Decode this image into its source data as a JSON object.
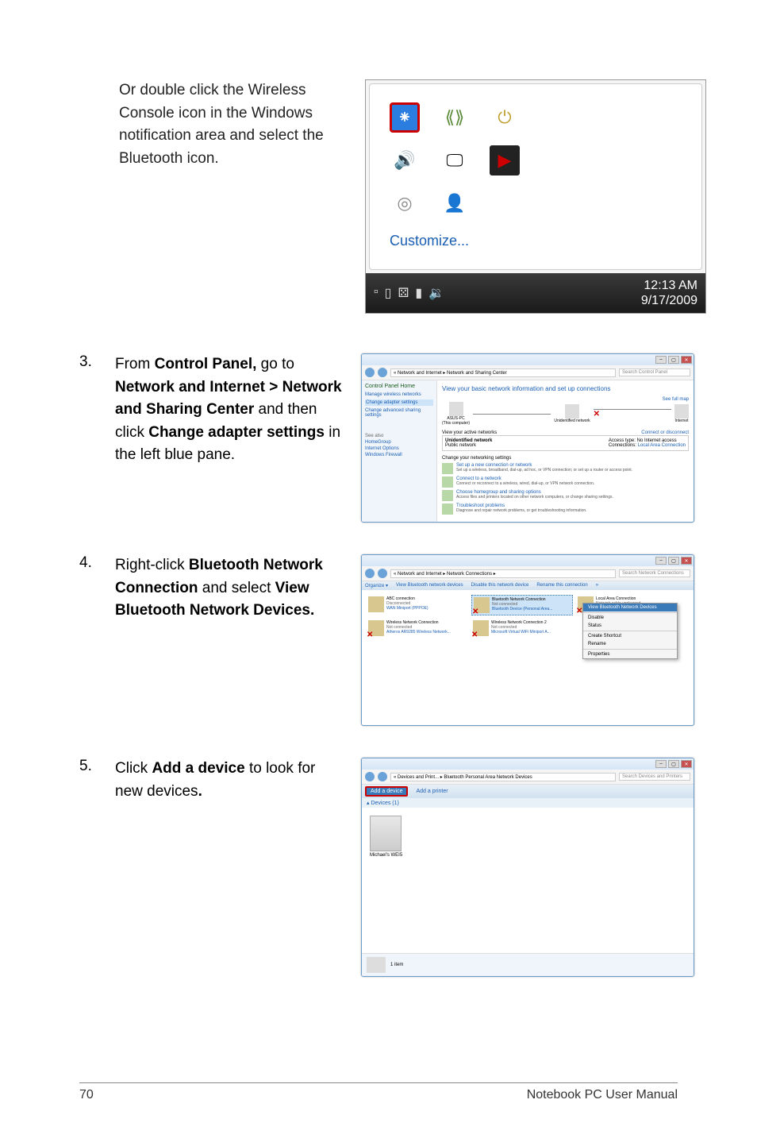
{
  "intro_text": "Or double click the Wireless Console icon in the Windows notification area and select the Bluetooth icon.",
  "steps": {
    "s3": {
      "num": "3.",
      "text_pre": "From ",
      "b1": "Control Panel,",
      "t2": " go to ",
      "b2": "Network and Internet > Network and Sharing Center",
      "t3": " and then click ",
      "b3": "Change adapter settings",
      "t4": " in the left blue pane."
    },
    "s4": {
      "num": "4.",
      "t1": "Right-click ",
      "b1": "Bluetooth Network Connection",
      "t2": " and select ",
      "b2": "View Bluetooth Network Devices."
    },
    "s5": {
      "num": "5.",
      "t1": "Click ",
      "b1": "Add a device",
      "t2": " to look for new devices",
      "b2": "."
    }
  },
  "systray": {
    "customize": "Customize...",
    "clock_time": "12:13 AM",
    "clock_date": "9/17/2009"
  },
  "ncs": {
    "path": "« Network and Internet ▸ Network and Sharing Center",
    "search_ph": "Search Control Panel",
    "sidebar_title": "Control Panel Home",
    "sb_links": [
      "Manage wireless networks",
      "Change adapter settings",
      "Change advanced sharing settings"
    ],
    "seealso_title": "See also",
    "seealso": [
      "HomeGroup",
      "Internet Options",
      "Windows Firewall"
    ],
    "heading": "View your basic network information and set up connections",
    "full_map": "See full map",
    "node1": "ASUS-PC",
    "node1b": "(This computer)",
    "node2": "Unidentified network",
    "node3": "Internet",
    "active_nets": "View your active networks",
    "conn_disc": "Connect or disconnect",
    "unid": "Unidentified network",
    "pubnet": "Public network",
    "acc_type": "Access type:",
    "acc_val": "No Internet access",
    "conns": "Connections:",
    "conns_val": "Local Area Connection",
    "change_hdr": "Change your networking settings",
    "opt1_t": "Set up a new connection or network",
    "opt1_d": "Set up a wireless, broadband, dial-up, ad hoc, or VPN connection; or set up a router or access point.",
    "opt2_t": "Connect to a network",
    "opt2_d": "Connect or reconnect to a wireless, wired, dial-up, or VPN network connection.",
    "opt3_t": "Choose homegroup and sharing options",
    "opt3_d": "Access files and printers located on other network computers, or change sharing settings.",
    "opt4_t": "Troubleshoot problems",
    "opt4_d": "Diagnose and repair network problems, or get troubleshooting information."
  },
  "netconn": {
    "path": "« Network and Internet ▸ Network Connections ▸",
    "search_ph": "Search Network Connections",
    "tb": [
      "Organize ▾",
      "View Bluetooth network devices",
      "Disable this network device",
      "Rename this connection",
      "»"
    ],
    "items": [
      {
        "n1": "ABC connection",
        "n2": "Disconnected",
        "n3": "WAN Miniport (PPPOE)"
      },
      {
        "n1": "Bluetooth Network Connection",
        "n2": "Not connected",
        "n3": "Bluetooth Device (Personal Area..."
      },
      {
        "n1": "Local Area Connection",
        "n2": "Network cable unplugged",
        "n3": ""
      },
      {
        "n1": "Wireless Network Connection",
        "n2": "Not connected",
        "n3": "Atheros AR9285 Wireless Network..."
      },
      {
        "n1": "Wireless Network Connection 2",
        "n2": "Not connected",
        "n3": "Microsoft Virtual WiFi Miniport A..."
      }
    ],
    "ctx": [
      "View Bluetooth Network Devices",
      "Disable",
      "Status",
      "Create Shortcut",
      "Rename",
      "Properties"
    ]
  },
  "devprint": {
    "path": "« Devices and Print... ▸ Bluetooth Personal Area Network Devices",
    "search_ph": "Search Devices and Printers",
    "add_device": "Add a device",
    "add_printer": "Add a printer",
    "section": "▴ Devices (1)",
    "device_name": "Michael's WEI5",
    "status": "1 item"
  },
  "footer": {
    "page": "70",
    "title": "Notebook PC User Manual"
  }
}
